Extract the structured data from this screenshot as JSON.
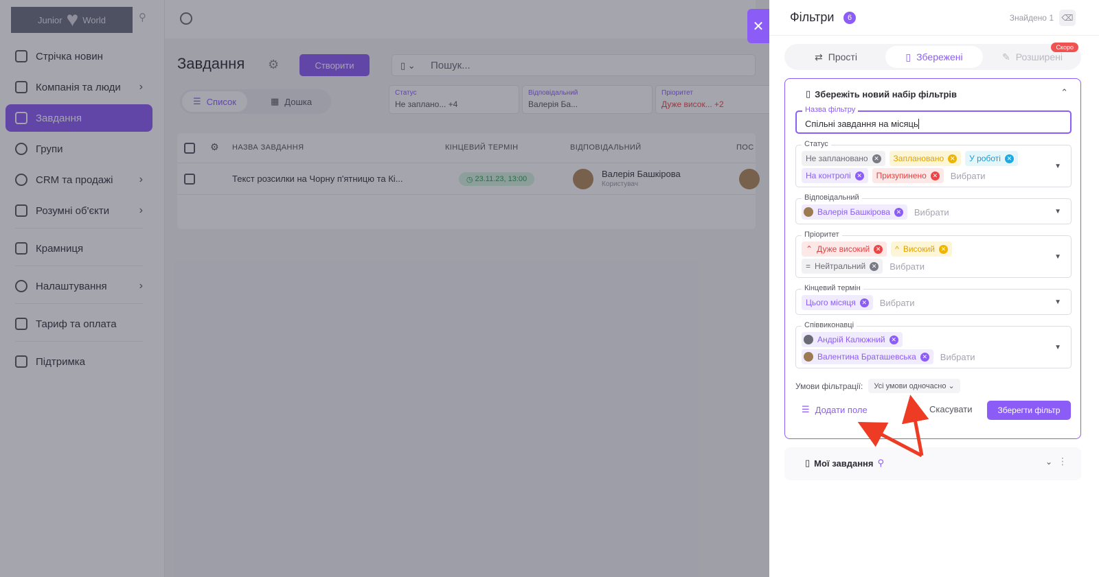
{
  "app": {
    "logo_left": "Junior",
    "logo_right": "World",
    "search_placeholder": "Пошук..."
  },
  "sidebar": {
    "items": [
      {
        "label": "Стрічка новин"
      },
      {
        "label": "Компанія та люди"
      },
      {
        "label": "Завдання"
      },
      {
        "label": "Групи"
      },
      {
        "label": "CRM та продажі"
      },
      {
        "label": "Розумні об'єкти"
      },
      {
        "label": "Крамниця"
      },
      {
        "label": "Налаштування"
      },
      {
        "label": "Тариф та оплата"
      },
      {
        "label": "Підтримка"
      }
    ]
  },
  "main": {
    "title": "Завдання",
    "create_label": "Створити",
    "view_list": "Список",
    "view_board": "Дошка",
    "filters": [
      {
        "label": "Статус",
        "value": "Не заплано... +4"
      },
      {
        "label": "Відповідальний",
        "value": "Валерія Ба..."
      },
      {
        "label": "Пріоритет",
        "value": "Дуже висок... +2"
      }
    ],
    "columns": {
      "name": "НАЗВА ЗАВДАННЯ",
      "deadline": "КІНЦЕВИЙ ТЕРМІН",
      "assignee": "ВІДПОВІДАЛЬНИЙ",
      "next": "ПОС"
    },
    "row": {
      "name": "Текст розсилки на Чорну п'ятницю та Кі...",
      "deadline": "23.11.23, 13:00",
      "assignee": "Валерія Башкірова",
      "role": "Користувач"
    }
  },
  "panel": {
    "title": "Фільтри",
    "badge": "6",
    "found": "Знайдено 1",
    "tabs": {
      "simple": "Прості",
      "saved": "Збережені",
      "advanced": "Розширені",
      "soon": "Скоро"
    },
    "save_title": "Збережіть новий набір фільтрів",
    "name_label": "Назва фільтру",
    "name_value": "Спільні завдання на місяць",
    "placeholder": "Вибрати",
    "status_label": "Статус",
    "status_chips": [
      "Не заплановано",
      "Заплановано",
      "У роботі",
      "На контролі",
      "Призупинено"
    ],
    "assignee_label": "Відповідальний",
    "assignee_chip": "Валерія Башкірова",
    "priority_label": "Пріоритет",
    "priority_chips": [
      "Дуже високий",
      "Високий",
      "Нейтральний"
    ],
    "deadline_label": "Кінцевий термін",
    "deadline_chip": "Цього місяця",
    "coexec_label": "Співвиконавці",
    "coexec_chips": [
      "Андрій Калюжний",
      "Валентина Браташевська"
    ],
    "conditions_label": "Умови фільтрації:",
    "conditions_value": "Усі умови одночасно",
    "add_field": "Додати поле",
    "cancel": "Скасувати",
    "save": "Зберегти фільтр",
    "my_tasks": "Мої завдання"
  },
  "colors": {
    "accent": "#8b5cf6",
    "danger": "#ef4444"
  }
}
